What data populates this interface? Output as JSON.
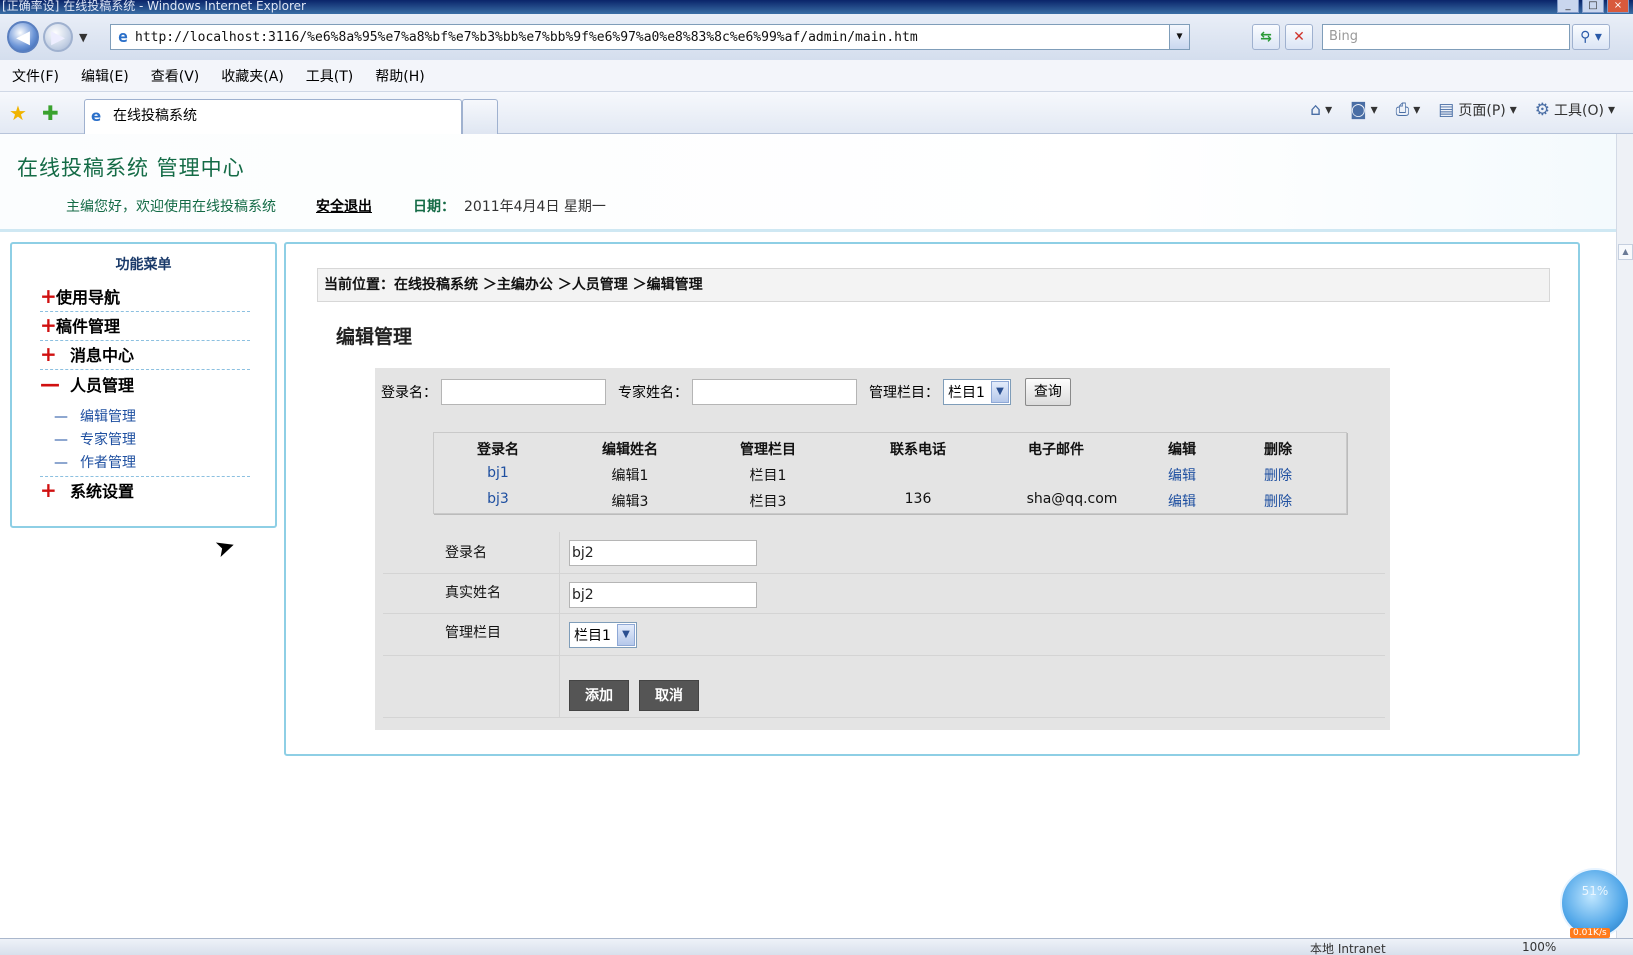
{
  "window": {
    "title": "在线投稿系统 - Windows Internet Explorer",
    "title_prefix": "[正确率设]"
  },
  "browser": {
    "url": "http://localhost:3116/%e6%8a%95%e7%a8%bf%e7%b3%bb%e7%bb%9f%e6%97%a0%e8%83%8c%e6%99%af/admin/main.htm",
    "search_placeholder": "Bing",
    "menu": [
      "文件(F)",
      "编辑(E)",
      "查看(V)",
      "收藏夹(A)",
      "工具(T)",
      "帮助(H)"
    ],
    "tab_title": "在线投稿系统",
    "command": {
      "page": "页面(P)",
      "tools": "工具(O)"
    },
    "status": {
      "zone": "本地 Intranet",
      "zoom": "100%"
    },
    "monitor": {
      "percent": "51%",
      "speed": "0.01K/s"
    }
  },
  "header": {
    "title": "在线投稿系统  管理中心",
    "welcome": "主编您好，欢迎使用在线投稿系统",
    "logout": "安全退出",
    "date_label": "日期：",
    "date_value": "2011年4月4日 星期一"
  },
  "sidebar": {
    "title": "功能菜单",
    "items": [
      {
        "mark": "+",
        "label": "使用导航"
      },
      {
        "mark": "+",
        "label": "稿件管理"
      },
      {
        "mark": "+",
        "label": "消息中心"
      },
      {
        "mark": "—",
        "label": "人员管理"
      },
      {
        "mark": "+",
        "label": "系统设置"
      }
    ],
    "subitems": [
      {
        "label": "编辑管理"
      },
      {
        "label": "专家管理"
      },
      {
        "label": "作者管理"
      }
    ],
    "sub_dash": "—"
  },
  "main": {
    "breadcrumb": "当前位置：在线投稿系统 ＞主编办公 ＞人员管理 ＞编辑管理",
    "title": "编辑管理",
    "filter": {
      "login_label": "登录名：",
      "login_value": "",
      "expert_label": "专家姓名：",
      "expert_value": "",
      "column_label": "管理栏目：",
      "column_value": "栏目1",
      "query_button": "查询"
    },
    "table": {
      "headers": [
        "登录名",
        "编辑姓名",
        "管理栏目",
        "联系电话",
        "电子邮件",
        "编辑",
        "删除"
      ],
      "rows": [
        {
          "login": "bj1",
          "name": "编辑1",
          "column": "栏目1",
          "phone": "",
          "email": "",
          "edit": "编辑",
          "delete": "删除"
        },
        {
          "login": "bj3",
          "name": "编辑3",
          "column": "栏目3",
          "phone": "136",
          "email": "sha@qq.com",
          "edit": "编辑",
          "delete": "删除"
        }
      ]
    },
    "form": {
      "login_label": "登录名",
      "login_value": "bj2",
      "realname_label": "真实姓名",
      "realname_value": "bj2",
      "column_label": "管理栏目",
      "column_value": "栏目1",
      "add_button": "添加",
      "cancel_button": "取消"
    }
  }
}
